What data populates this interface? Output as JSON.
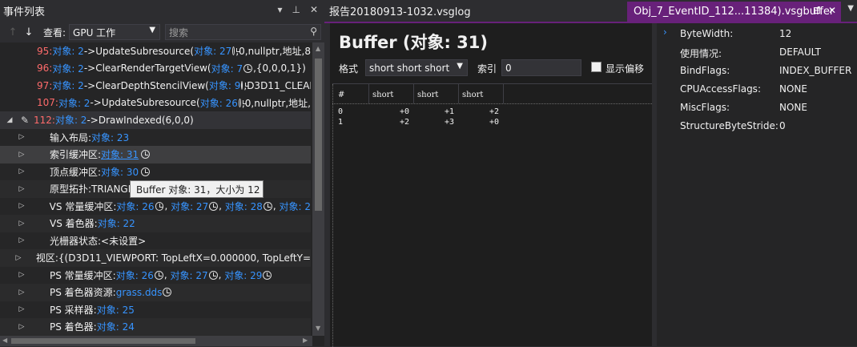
{
  "left_panel": {
    "title": "事件列表",
    "title_icons": [
      "dropdown-icon",
      "pin-icon",
      "close-icon"
    ],
    "view_label": "查看:",
    "view_value": "GPU 工作",
    "search_placeholder": "搜索",
    "events": [
      {
        "num": "95:",
        "obj": " 对象: 2",
        "call": "->UpdateSubresource(",
        "arg_obj": "对象: 27",
        "rest": ",0,nullptr,地址,8"
      },
      {
        "num": "96:",
        "obj": " 对象: 2",
        "call": "->ClearRenderTargetView(",
        "arg_obj": "对象: 7",
        "rest": ",{0,0,0,1})"
      },
      {
        "num": "97:",
        "obj": " 对象: 2",
        "call": "->ClearDepthStencilView(",
        "arg_obj": "对象: 9",
        "rest": ",D3D11_CLEAR"
      },
      {
        "num": "107:",
        "obj": " 对象: 2",
        "call": "->UpdateSubresource(",
        "arg_obj": "对象: 26",
        "rest": ",0,nullptr,地址,"
      },
      {
        "num": "112:",
        "obj": " 对象: 2",
        "call": "->DrawIndexed(6,0,0)"
      }
    ],
    "children": [
      {
        "label": "输入布局:",
        "link": "对象: 23"
      },
      {
        "label": "索引缓冲区:",
        "link": "对象: 31"
      },
      {
        "label": "顶点缓冲区:",
        "link": "对象: 30"
      },
      {
        "label": "原型拓扑:TRIANGL"
      },
      {
        "label": "VS 常量缓冲区:",
        "link": "对象: 26",
        "link2": "对象: 27",
        "link3": "对象: 28",
        "link4": "对象: 2"
      },
      {
        "label": "VS 着色器:",
        "link": "对象: 22"
      },
      {
        "label": "光栅器状态:<未设置>"
      },
      {
        "label": "视区:{(D3D11_VIEWPORT: TopLeftX=0.000000, TopLeftY="
      },
      {
        "label": "PS 常量缓冲区:",
        "link": "对象: 26",
        "link2": "对象: 27",
        "link3": "对象: 29"
      },
      {
        "label": "PS 着色器资源:",
        "link": "grass.dds"
      },
      {
        "label": "PS 采样器:",
        "link": "对象: 25"
      },
      {
        "label": "PS 着色器:",
        "link": "对象: 24"
      }
    ],
    "tooltip": "Buffer 对象: 31，大小为 12"
  },
  "tabs": {
    "tab1": "报告20180913-1032.vsglog",
    "tab2": "Obj_7_EventID_112...11384).vsgbuffer"
  },
  "buffer": {
    "title": "Buffer (对象: 31)",
    "format_label": "格式",
    "format_value": "short short short",
    "index_label": "索引",
    "index_value": "0",
    "offset_label": "显示偏移",
    "columns": [
      "#",
      "short",
      "short",
      "short"
    ],
    "rows": [
      [
        "0",
        "+0",
        "+1",
        "+2"
      ],
      [
        "1",
        "+2",
        "+3",
        "+0"
      ]
    ]
  },
  "properties": [
    {
      "key": "ByteWidth:",
      "value": "12"
    },
    {
      "key": "使用情况:",
      "value": "DEFAULT"
    },
    {
      "key": "BindFlags:",
      "value": "INDEX_BUFFER"
    },
    {
      "key": "CPUAccessFlags:",
      "value": "NONE"
    },
    {
      "key": "MiscFlags:",
      "value": "NONE"
    },
    {
      "key": "StructureByteStride:",
      "value": "0"
    }
  ],
  "colors": {
    "accent": "#68217a",
    "link": "#3794ff",
    "event_num": "#ff6b6b"
  }
}
